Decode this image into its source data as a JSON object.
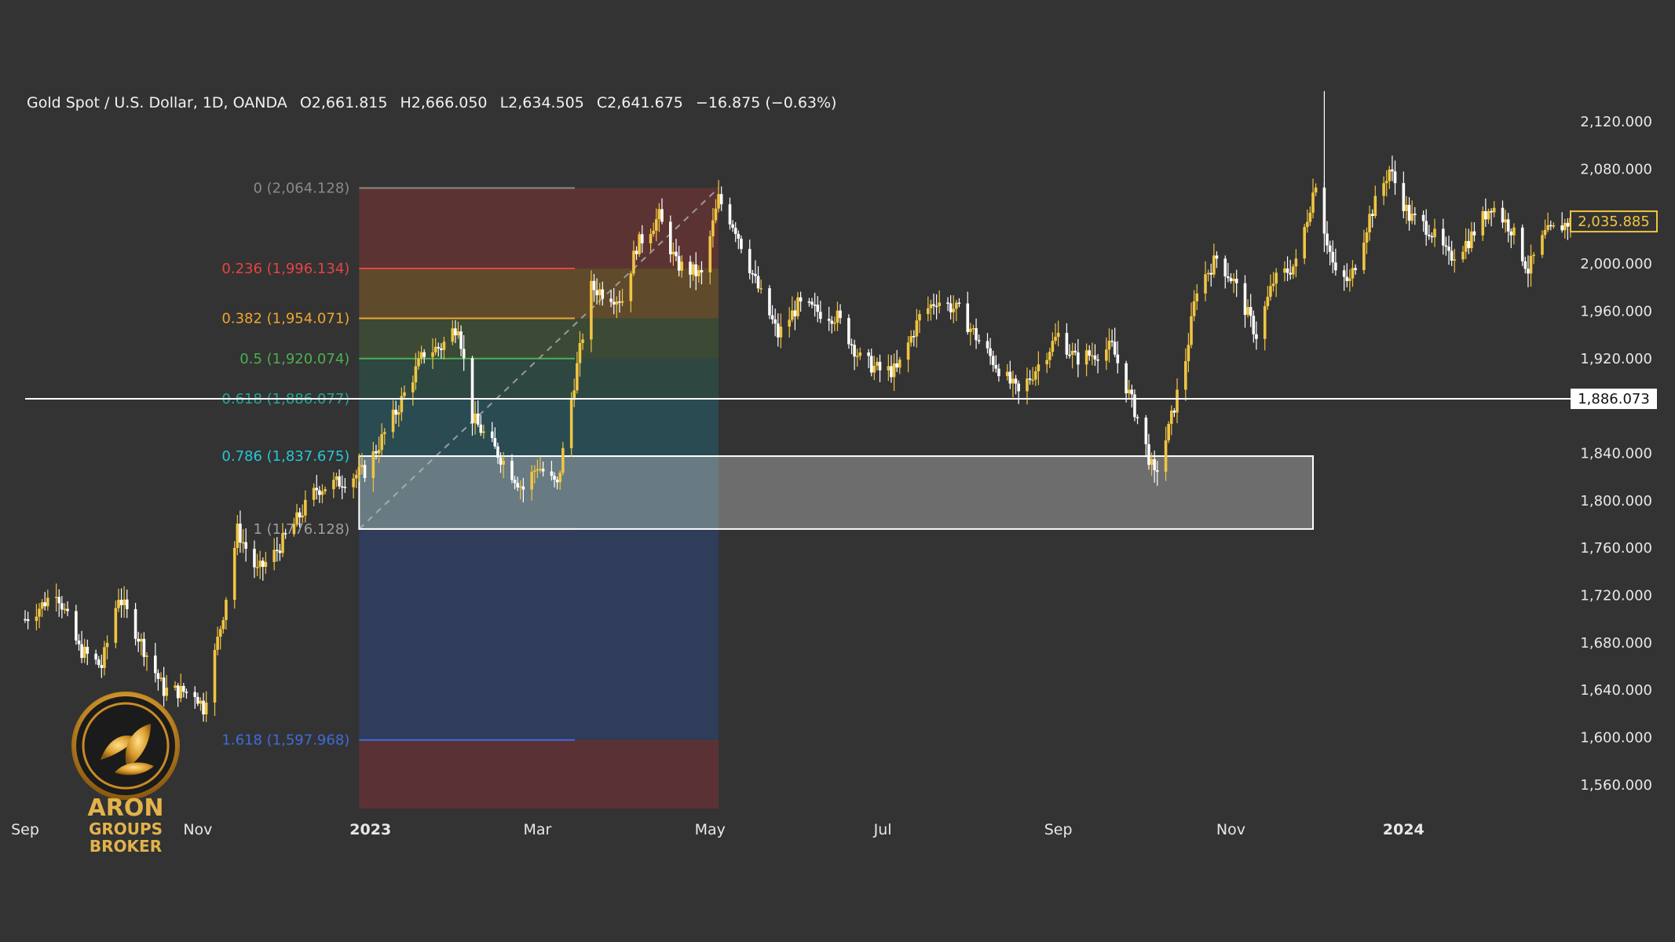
{
  "header": {
    "symbol": "Gold Spot / U.S. Dollar, 1D, OANDA",
    "open": "O2,661.815",
    "high": "H2,666.050",
    "low": "L2,634.505",
    "close": "C2,641.675",
    "change": "−16.875 (−0.63%)"
  },
  "logo": {
    "line1": "ARON",
    "line2": "GROUPS",
    "line3": "BROKER"
  },
  "colors": {
    "background": "#333333",
    "up_candle": "#f0c542",
    "down_candle": "#ffffff",
    "price_tag": "#f0c542"
  },
  "chart_data": {
    "type": "candlestick",
    "title": "Gold Spot / U.S. Dollar, 1D, OANDA",
    "x_range": [
      "2022-09-01",
      "2024-02-29"
    ],
    "ylim": [
      1540,
      2150
    ],
    "y_ticks": [
      "2,120.000",
      "2,080.000",
      "2,000.000",
      "1,960.000",
      "1,920.000",
      "1,840.000",
      "1,800.000",
      "1,760.000",
      "1,720.000",
      "1,680.000",
      "1,640.000",
      "1,600.000",
      "1,560.000"
    ],
    "x_ticks": [
      {
        "label": "Sep",
        "date": "2022-09-01"
      },
      {
        "label": "Nov",
        "date": "2022-11-01"
      },
      {
        "label": "2023",
        "date": "2023-01-01"
      },
      {
        "label": "Mar",
        "date": "2023-03-01"
      },
      {
        "label": "May",
        "date": "2023-05-01"
      },
      {
        "label": "Jul",
        "date": "2023-07-01"
      },
      {
        "label": "Sep",
        "date": "2023-09-01"
      },
      {
        "label": "Nov",
        "date": "2023-11-01"
      },
      {
        "label": "2024",
        "date": "2024-01-01"
      }
    ],
    "price_path": [
      [
        "2022-09-01",
        1700
      ],
      [
        "2022-09-07",
        1712
      ],
      [
        "2022-09-12",
        1725
      ],
      [
        "2022-09-20",
        1675
      ],
      [
        "2022-09-28",
        1660
      ],
      [
        "2022-10-04",
        1720
      ],
      [
        "2022-10-10",
        1690
      ],
      [
        "2022-10-20",
        1640
      ],
      [
        "2022-10-31",
        1638
      ],
      [
        "2022-11-03",
        1625
      ],
      [
        "2022-11-10",
        1705
      ],
      [
        "2022-11-15",
        1775
      ],
      [
        "2022-11-22",
        1740
      ],
      [
        "2022-11-28",
        1755
      ],
      [
        "2022-12-05",
        1780
      ],
      [
        "2022-12-13",
        1810
      ],
      [
        "2022-12-20",
        1815
      ],
      [
        "2022-12-30",
        1825
      ],
      [
        "2023-01-10",
        1875
      ],
      [
        "2023-01-20",
        1925
      ],
      [
        "2023-01-26",
        1930
      ],
      [
        "2023-02-01",
        1950
      ],
      [
        "2023-02-06",
        1870
      ],
      [
        "2023-02-15",
        1840
      ],
      [
        "2023-02-24",
        1810
      ],
      [
        "2023-03-01",
        1830
      ],
      [
        "2023-03-08",
        1812
      ],
      [
        "2023-03-14",
        1900
      ],
      [
        "2023-03-20",
        1980
      ],
      [
        "2023-03-31",
        1970
      ],
      [
        "2023-04-05",
        2015
      ],
      [
        "2023-04-13",
        2040
      ],
      [
        "2023-04-19",
        2000
      ],
      [
        "2023-04-28",
        1990
      ],
      [
        "2023-05-04",
        2055
      ],
      [
        "2023-05-10",
        2030
      ],
      [
        "2023-05-17",
        1985
      ],
      [
        "2023-05-25",
        1940
      ],
      [
        "2023-06-01",
        1965
      ],
      [
        "2023-06-15",
        1955
      ],
      [
        "2023-06-23",
        1920
      ],
      [
        "2023-06-30",
        1910
      ],
      [
        "2023-07-06",
        1910
      ],
      [
        "2023-07-14",
        1955
      ],
      [
        "2023-07-20",
        1970
      ],
      [
        "2023-07-28",
        1960
      ],
      [
        "2023-08-04",
        1935
      ],
      [
        "2023-08-10",
        1915
      ],
      [
        "2023-08-18",
        1890
      ],
      [
        "2023-08-25",
        1915
      ],
      [
        "2023-09-01",
        1940
      ],
      [
        "2023-09-07",
        1920
      ],
      [
        "2023-09-15",
        1925
      ],
      [
        "2023-09-20",
        1930
      ],
      [
        "2023-09-29",
        1870
      ],
      [
        "2023-10-05",
        1820
      ],
      [
        "2023-10-10",
        1860
      ],
      [
        "2023-10-16",
        1920
      ],
      [
        "2023-10-20",
        1980
      ],
      [
        "2023-10-27",
        2005
      ],
      [
        "2023-11-02",
        1985
      ],
      [
        "2023-11-10",
        1940
      ],
      [
        "2023-11-16",
        1985
      ],
      [
        "2023-11-24",
        2000
      ],
      [
        "2023-12-01",
        2070
      ],
      [
        "2023-12-04",
        2030
      ],
      [
        "2023-12-08",
        1990
      ],
      [
        "2023-12-13",
        1985
      ],
      [
        "2023-12-20",
        2040
      ],
      [
        "2023-12-27",
        2080
      ],
      [
        "2024-01-03",
        2040
      ],
      [
        "2024-01-10",
        2030
      ],
      [
        "2024-01-17",
        2005
      ],
      [
        "2024-01-24",
        2020
      ],
      [
        "2024-02-01",
        2050
      ],
      [
        "2024-02-08",
        2030
      ],
      [
        "2024-02-14",
        1995
      ],
      [
        "2024-02-20",
        2025
      ],
      [
        "2024-02-29",
        2036
      ]
    ],
    "current_price": "2,035.885",
    "horizontal_line": {
      "value": 1886.073,
      "label": "1,886.073"
    },
    "fibonacci": {
      "start_date": "2022-12-28",
      "end_date": "2023-05-04",
      "levels": [
        {
          "ratio": 0,
          "price": 2064.128,
          "label": "0 (2,064.128)",
          "color": "#8a8a8a"
        },
        {
          "ratio": 0.236,
          "price": 1996.134,
          "label": "0.236 (1,996.134)",
          "color": "#e84343"
        },
        {
          "ratio": 0.382,
          "price": 1954.071,
          "label": "0.382 (1,954.071)",
          "color": "#f0a530"
        },
        {
          "ratio": 0.5,
          "price": 1920.074,
          "label": "0.5 (1,920.074)",
          "color": "#4caf50"
        },
        {
          "ratio": 0.618,
          "price": 1886.077,
          "label": "0.618 (1,886.077)",
          "color": "#26a69a"
        },
        {
          "ratio": 0.786,
          "price": 1837.675,
          "label": "0.786 (1,837.675)",
          "color": "#26c6da"
        },
        {
          "ratio": 1,
          "price": 1776.128,
          "label": "1 (1,776.128)",
          "color": "#9e9e9e"
        },
        {
          "ratio": 1.618,
          "price": 1597.968,
          "label": "1.618 (1,597.968)",
          "color": "#3f6be0"
        }
      ],
      "bands": [
        {
          "from": 2064.128,
          "to": 1996.134,
          "color": "#5c3333"
        },
        {
          "from": 1996.134,
          "to": 1954.071,
          "color": "#5f4a2c"
        },
        {
          "from": 1954.071,
          "to": 1920.074,
          "color": "#3b4935"
        },
        {
          "from": 1920.074,
          "to": 1886.077,
          "color": "#2e4741"
        },
        {
          "from": 1886.077,
          "to": 1837.675,
          "color": "#2a4b52"
        },
        {
          "from": 1837.675,
          "to": 1776.128,
          "color": "#2a4b56"
        },
        {
          "from": 1776.128,
          "to": 1597.968,
          "color": "#2f3c5a"
        },
        {
          "from": 1597.968,
          "to": 1540,
          "color": "#5a3236"
        }
      ]
    },
    "support_zone": {
      "from_date": "2022-12-28",
      "to_date": "2023-11-30",
      "top": 1837.675,
      "bottom": 1776.128
    }
  }
}
